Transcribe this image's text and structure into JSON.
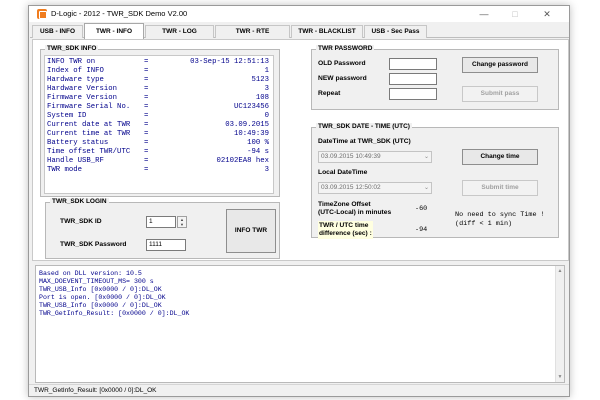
{
  "window": {
    "title": "D-Logic - 2012 - TWR_SDK Demo V2.00",
    "controls": {
      "minimize": "—",
      "maximize": "□",
      "close": "✕"
    }
  },
  "tabs": [
    {
      "label": "USB - INFO",
      "active": false
    },
    {
      "label": "TWR - INFO",
      "active": true
    },
    {
      "label": "TWR - LOG",
      "active": false
    },
    {
      "label": "TWR - RTE",
      "active": false
    },
    {
      "label": "TWR - BLACKLIST",
      "active": false
    },
    {
      "label": "USB - Sec Pass",
      "active": false
    }
  ],
  "twr_sdk_info": {
    "title": "TWR_SDK INFO",
    "rows": [
      {
        "label": "INFO TWR on",
        "eq": "=",
        "value": "03-Sep-15 12:51:13"
      },
      {
        "label": "Index of INFO",
        "eq": "=",
        "value": "1"
      },
      {
        "label": "Hardware type",
        "eq": "=",
        "value": "5123"
      },
      {
        "label": "Hardware Version",
        "eq": "=",
        "value": "3"
      },
      {
        "label": "Firmware Version",
        "eq": "=",
        "value": "108"
      },
      {
        "label": "Firmware Serial No.",
        "eq": "=",
        "value": "UC123456"
      },
      {
        "label": "System ID",
        "eq": "=",
        "value": "0"
      },
      {
        "label": "Current date at TWR",
        "eq": "=",
        "value": "03.09.2015"
      },
      {
        "label": "Current time at TWR",
        "eq": "=",
        "value": "10:49:39"
      },
      {
        "label": "Battery status",
        "eq": "=",
        "value": "100 %"
      },
      {
        "label": "Time offset TWR/UTC",
        "eq": "=",
        "value": "-94 s"
      },
      {
        "label": "Handle USB_RF",
        "eq": "=",
        "value": "02102EA8 hex"
      },
      {
        "label": "TWR mode",
        "eq": "=",
        "value": "3"
      }
    ]
  },
  "twr_sdk_login": {
    "title": "TWR_SDK LOGIN",
    "id_label": "TWR_SDK ID",
    "id_value": "1",
    "password_label": "TWR_SDK Password",
    "password_value": "1111",
    "info_button": "INFO TWR"
  },
  "twr_password": {
    "title": "TWR PASSWORD",
    "old_label": "OLD Password",
    "new_label": "NEW password",
    "repeat_label": "Repeat",
    "change_button": "Change password",
    "submit_button": "Submit pass"
  },
  "twr_sdk_datetime": {
    "title": "TWR_SDK DATE - TIME (UTC)",
    "datetime_label": "DateTime at TWR_SDK (UTC)",
    "datetime_value": "03.09.2015 10:49:39",
    "change_button": "Change time",
    "local_label": "Local DateTime",
    "local_value": "03.09.2015 12:50:02",
    "submit_button": "Submit time",
    "tz_label_1": "TimeZone Offset",
    "tz_label_2": "(UTC-Local) in minutes",
    "tz_value": "-60",
    "diff_label_1": "TWR / UTC time",
    "diff_label_2": "difference (sec) :",
    "diff_value": "-94",
    "sync_note_1": "No need to sync Time !",
    "sync_note_2": "(diff < 1 min)"
  },
  "log": {
    "lines": [
      "Based on DLL version: 10.5",
      "MAX_DOEVENT_TIMEOUT_MS= 300 s",
      "TWR_USB_Info [0x0000 / 0]:DL_OK",
      "Port is open. [0x0000 / 0]:DL_OK",
      "TWR_USB_Info [0x0000 / 0]:DL_OK",
      "TWR_GetInfo_Result: [0x0000 / 0]:DL_OK"
    ]
  },
  "statusbar": {
    "text": "TWR_GetInfo_Result: [0x0000 / 0]:DL_OK"
  },
  "colors": {
    "info_text": "#00008b",
    "app_icon": "#f07c1e",
    "note_bg": "#ffffe0"
  }
}
